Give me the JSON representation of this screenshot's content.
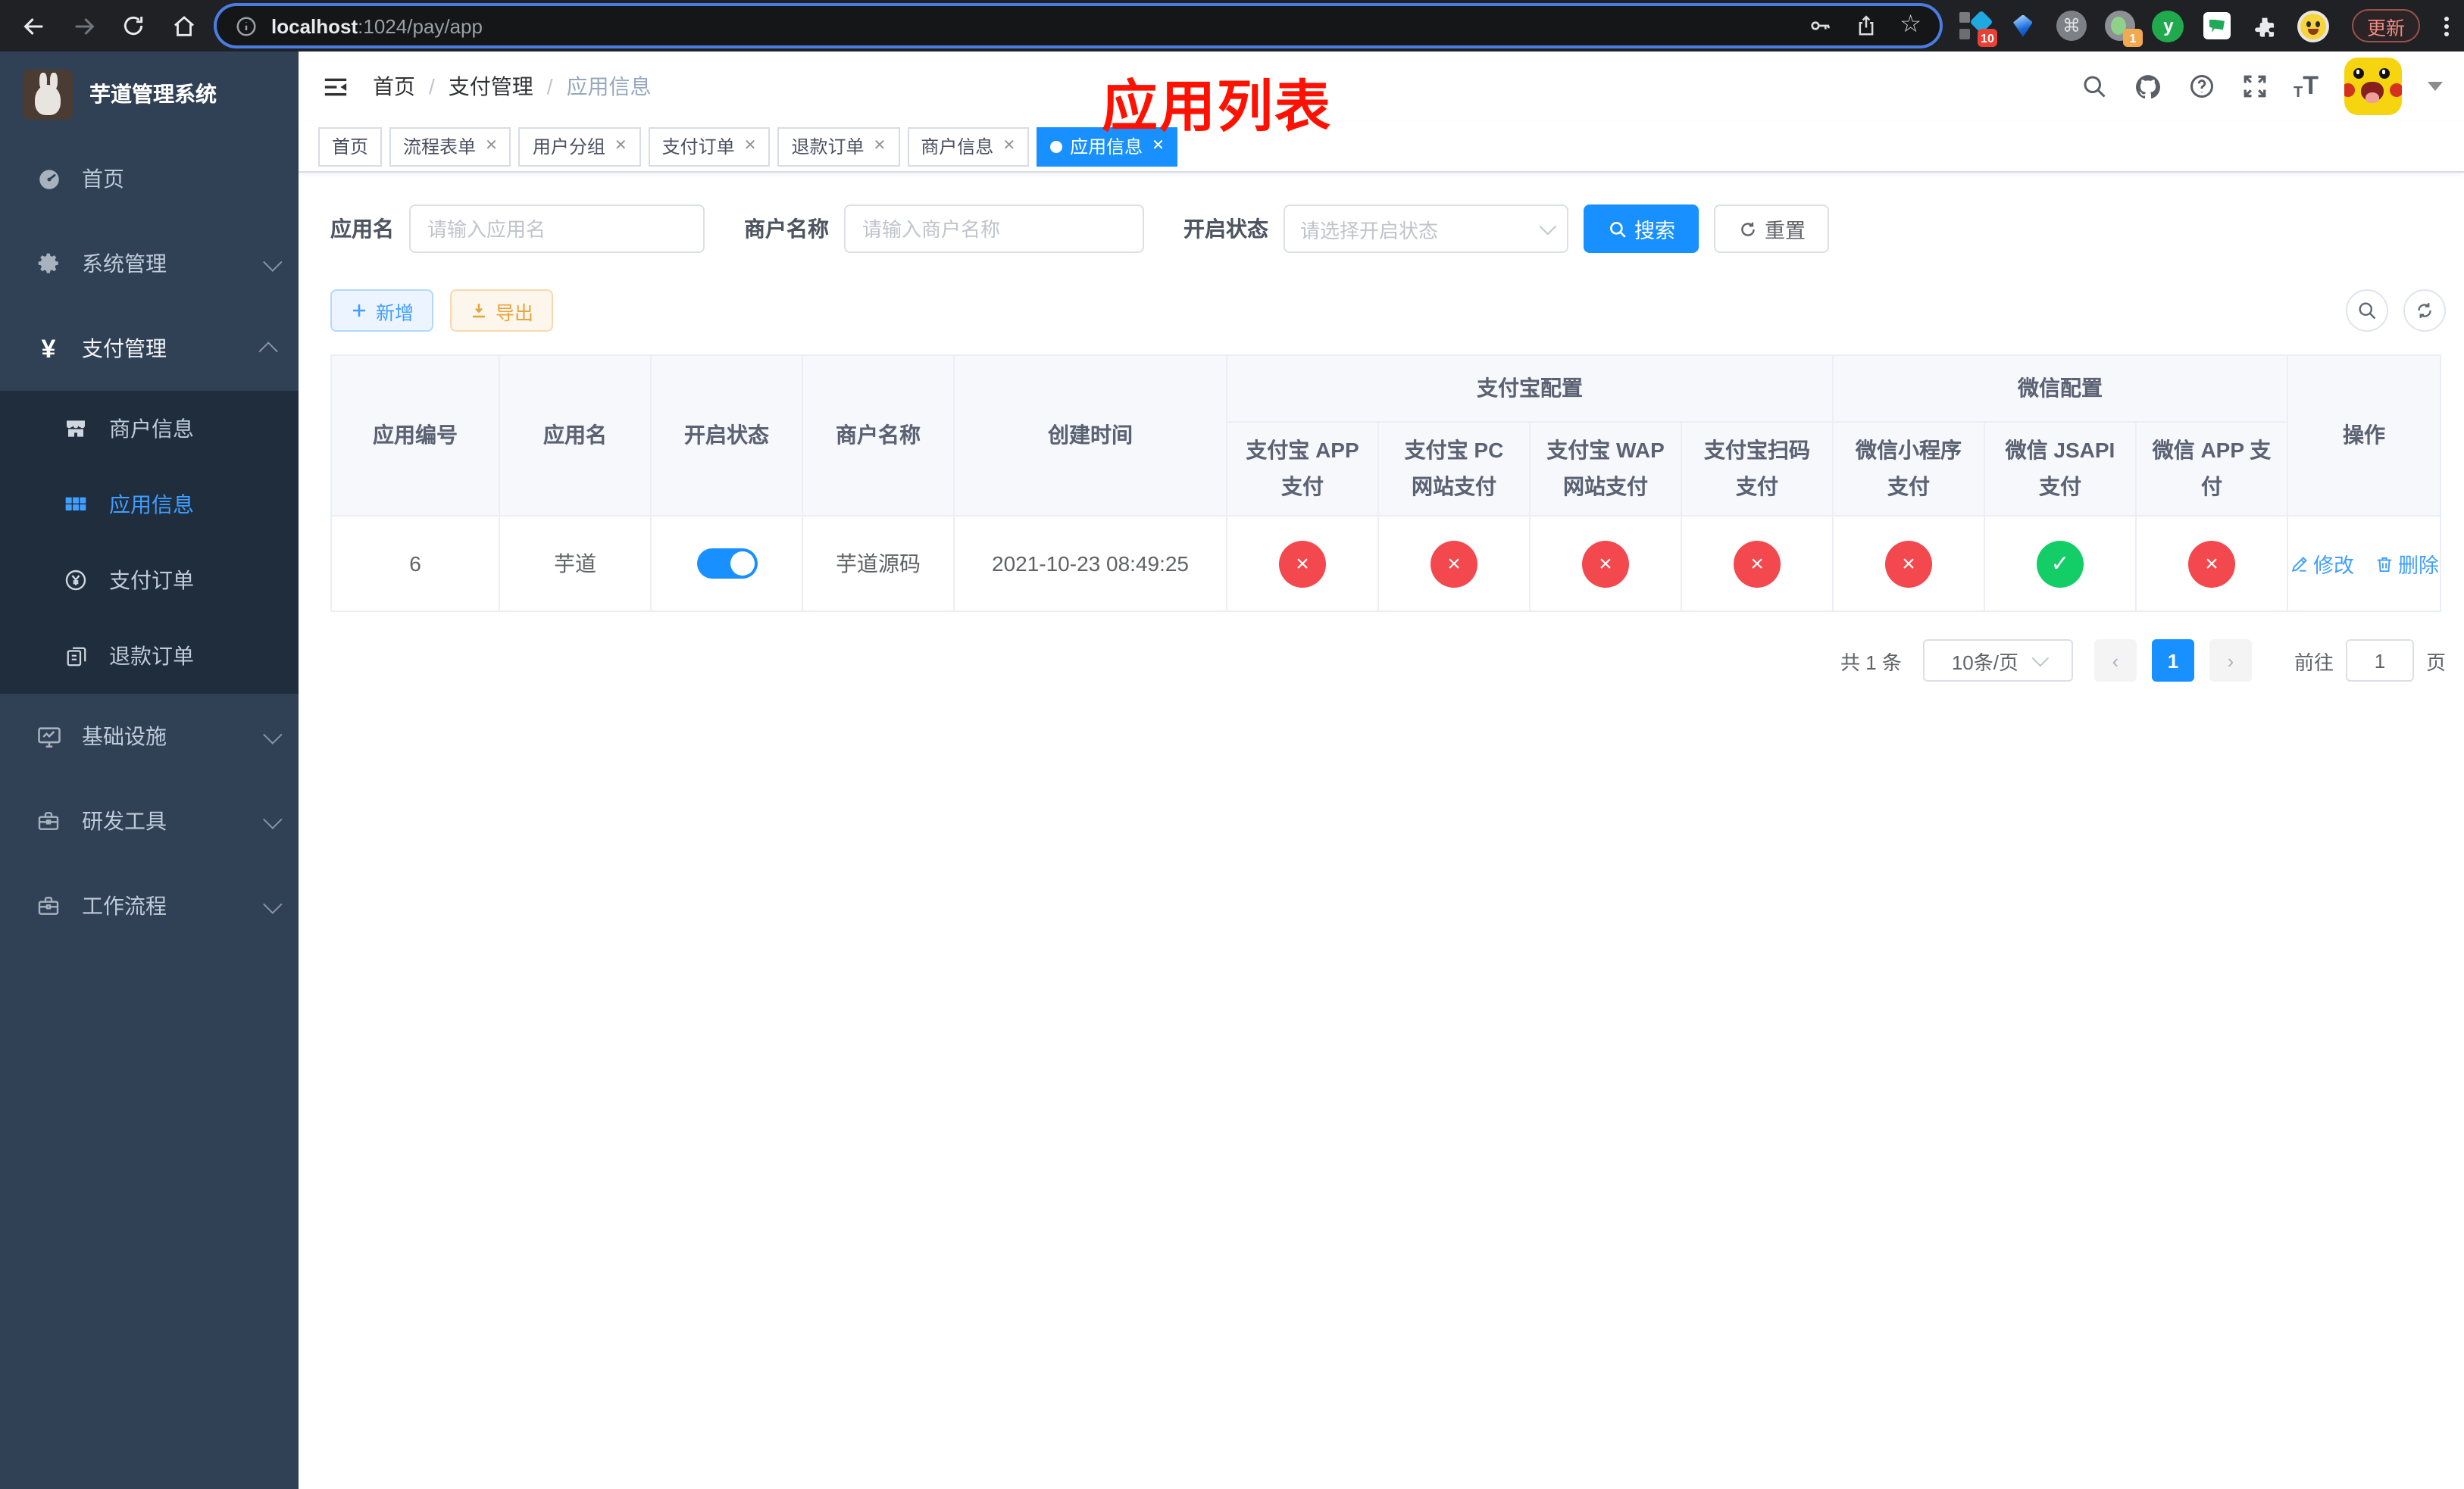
{
  "browser": {
    "url_host": "localhost",
    "url_rest": ":1024/pay/app",
    "update_label": "更新",
    "ext_badge_blue_diamond": "10",
    "ext_badge_camera": "1",
    "ext_y_label": "y",
    "command_glyph": "⌘",
    "star_glyph": "☆"
  },
  "sidebar": {
    "title": "芋道管理系统",
    "menu": [
      {
        "label": "首页"
      },
      {
        "label": "系统管理"
      },
      {
        "label": "支付管理"
      },
      {
        "label": "商户信息"
      },
      {
        "label": "应用信息"
      },
      {
        "label": "支付订单"
      },
      {
        "label": "退款订单"
      },
      {
        "label": "基础设施"
      },
      {
        "label": "研发工具"
      },
      {
        "label": "工作流程"
      }
    ],
    "yen_glyph": "¥"
  },
  "breadcrumb": {
    "home": "首页",
    "section": "支付管理",
    "current": "应用信息",
    "separator": "/"
  },
  "annotation": "应用列表",
  "tabs": [
    {
      "label": "首页"
    },
    {
      "label": "流程表单"
    },
    {
      "label": "用户分组"
    },
    {
      "label": "支付订单"
    },
    {
      "label": "退款订单"
    },
    {
      "label": "商户信息"
    },
    {
      "label": "应用信息"
    }
  ],
  "tab_close_glyph": "✕",
  "filters": {
    "app_name_label": "应用名",
    "app_name_placeholder": "请输入应用名",
    "merchant_label": "商户名称",
    "merchant_placeholder": "请输入商户名称",
    "status_label": "开启状态",
    "status_placeholder": "请选择开启状态",
    "search_label": "搜索",
    "reset_label": "重置"
  },
  "toolbar": {
    "add_label": "新增",
    "export_label": "导出"
  },
  "table": {
    "group_alipay": "支付宝配置",
    "group_wechat": "微信配置",
    "columns": {
      "app_id": "应用编号",
      "app_name": "应用名",
      "status": "开启状态",
      "merchant": "商户名称",
      "create_time": "创建时间",
      "alipay_app": "支付宝 APP 支付",
      "alipay_pc": "支付宝 PC 网站支付",
      "alipay_wap": "支付宝 WAP 网站支付",
      "alipay_qr": "支付宝扫码支付",
      "wx_mini": "微信小程序支付",
      "wx_jsapi": "微信 JSAPI 支付",
      "wx_app": "微信 APP 支付",
      "actions": "操作"
    },
    "row": {
      "app_id": "6",
      "app_name": "芋道",
      "status_on": true,
      "merchant": "芋道源码",
      "create_time": "2021-10-23 08:49:25",
      "pay_status": [
        "no",
        "no",
        "no",
        "no",
        "no",
        "yes",
        "no"
      ],
      "edit_label": "修改",
      "delete_label": "删除"
    },
    "status_yes_glyph": "✓",
    "status_no_glyph": "×"
  },
  "pagination": {
    "total_label": "共 1 条",
    "page_size_label": "10条/页",
    "prev_glyph": "‹",
    "next_glyph": "›",
    "page": "1",
    "goto_label": "前往",
    "page_unit_label": "页"
  },
  "colors": {
    "accent": "#1890ff",
    "link": "#409eff",
    "danger": "#f3484e",
    "success": "#13ce66",
    "sidebar_bg": "#304156",
    "submenu_bg": "#1f2d3d",
    "annotation_red": "#fe1100"
  }
}
